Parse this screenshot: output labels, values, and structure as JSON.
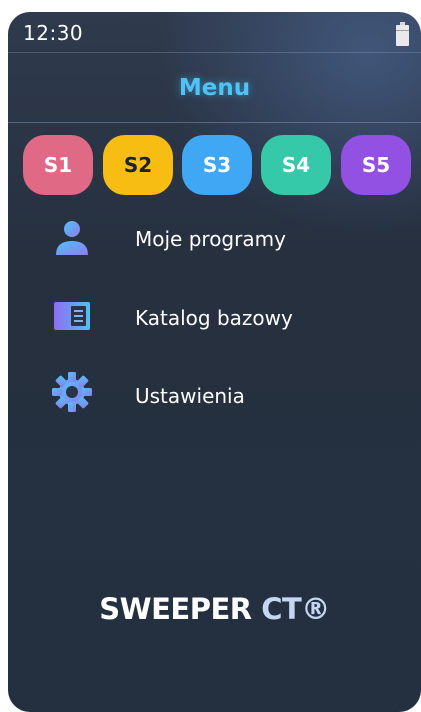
{
  "status": {
    "time": "12:30"
  },
  "header": {
    "title": "Menu"
  },
  "slots": [
    {
      "label": "S1",
      "color": "#e06a85"
    },
    {
      "label": "S2",
      "color": "#f7bd12"
    },
    {
      "label": "S3",
      "color": "#3fa7f4"
    },
    {
      "label": "S4",
      "color": "#35c9a9"
    },
    {
      "label": "S5",
      "color": "#9351e3"
    }
  ],
  "menu": {
    "items": [
      {
        "label": "Moje programy",
        "icon": "user-icon"
      },
      {
        "label": "Katalog bazowy",
        "icon": "catalog-icon"
      },
      {
        "label": "Ustawienia",
        "icon": "gear-icon"
      }
    ]
  },
  "brand": {
    "name": "SWEEPER",
    "suffix": "CT®"
  },
  "colors": {
    "accent": "#4fc3f7",
    "background": "#26303f"
  }
}
